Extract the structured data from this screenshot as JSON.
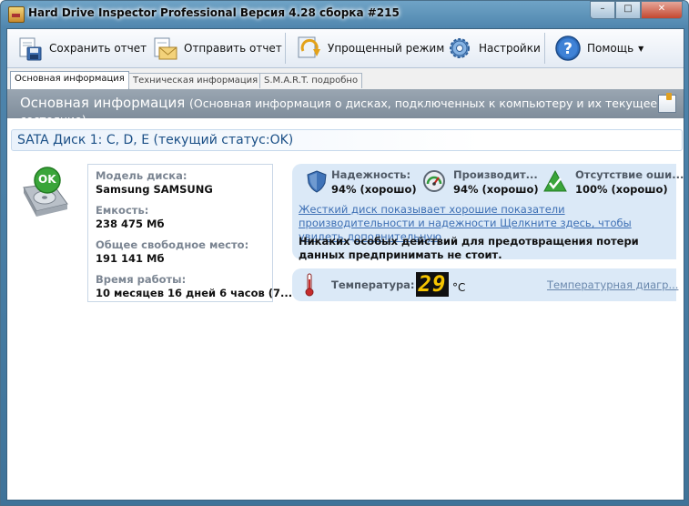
{
  "window": {
    "title": "Hard Drive Inspector Professional Версия 4.28 сборка #215",
    "controls": {
      "minimize": "–",
      "maximize": "□",
      "close": "✕"
    }
  },
  "toolbar": {
    "save_label": "Сохранить отчет",
    "send_label": "Отправить отчет",
    "simple_mode_label": "Упрощенный режим",
    "settings_label": "Настройки",
    "help_label": "Помощь"
  },
  "tabs": [
    {
      "label": "Основная информация",
      "active": true
    },
    {
      "label": "Техническая информация",
      "active": false
    },
    {
      "label": "S.M.A.R.T. подробно",
      "active": false
    }
  ],
  "section": {
    "title": "Основная информация",
    "description": "(Основная информация о дисках, подключенных к компьютеру и  их текущее состояние)"
  },
  "disk": {
    "header": "SATA Диск 1: C, D, E (текущий статус:OK)",
    "status_badge": "OK",
    "model_label": "Модель диска:",
    "model_value": "Samsung SAMSUNG",
    "capacity_label": "Емкость:",
    "capacity_value": "238 475 Мб",
    "free_label": "Общее свободное место:",
    "free_value": "191 141 Мб",
    "uptime_label": "Время работы:",
    "uptime_value": "10 месяцев 16 дней 6 часов (7..."
  },
  "status": {
    "reliability_label": "Надежность:",
    "reliability_value": "94% (хорошо)",
    "performance_label": "Производит...",
    "performance_value": "94% (хорошо)",
    "errors_label": "Отсутствие оши...",
    "errors_value": "100% (хорошо)",
    "link_text": "Жесткий диск показывает хорошие показатели производительности и надежности Щелкните здесь, чтобы увидеть дополнительную",
    "note": "Никаких особых действий для предотвращения потери данных предпринимать не стоит."
  },
  "temperature": {
    "label": "Температура:",
    "value": "29",
    "unit": "°C",
    "diagram_link": "Температурная диагр..."
  },
  "colors": {
    "accent": "#1a4f86",
    "link": "#3d6fb4",
    "panel": "#dbe9f7",
    "ok_green": "#3aa53a",
    "lcd": "#f5c400"
  },
  "icons": {
    "save": "floppy-save-icon",
    "send": "envelope-send-icon",
    "simple_mode": "refresh-arrow-icon",
    "settings": "gear-icon",
    "help": "question-icon",
    "drive": "hard-drive-icon",
    "reliability": "shield-icon",
    "performance": "gauge-icon",
    "errors": "check-triangle-icon",
    "temperature": "thermometer-icon"
  }
}
